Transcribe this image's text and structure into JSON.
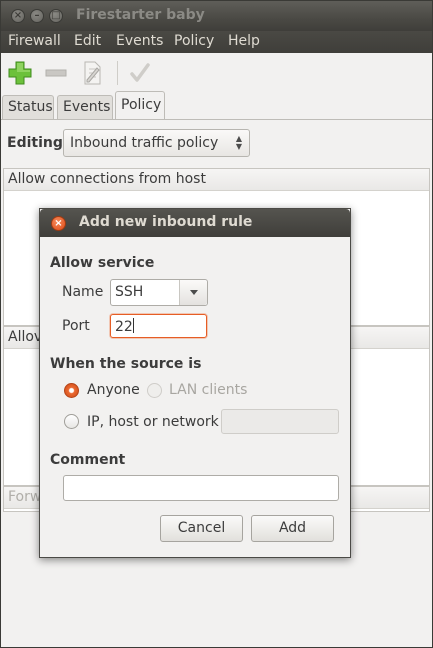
{
  "window": {
    "title": "Firestarter baby",
    "controls": {
      "close": "close-icon",
      "minimize": "minimize-icon",
      "maximize": "maximize-icon"
    }
  },
  "menubar": {
    "items": [
      "Firewall",
      "Edit",
      "Events",
      "Policy",
      "Help"
    ]
  },
  "toolbar": {
    "icons": [
      "add-icon",
      "remove-icon",
      "edit-icon",
      "apply-icon"
    ]
  },
  "tabs": [
    {
      "label": "Status",
      "active": false
    },
    {
      "label": "Events",
      "active": false
    },
    {
      "label": "Policy",
      "active": true
    }
  ],
  "policy": {
    "editing_label": "Editing",
    "selected_policy": "Inbound traffic policy",
    "sections": {
      "allow_host": "Allow connections from host",
      "allow_service_partial": "Allov",
      "forward_partial": "Forw"
    }
  },
  "dialog": {
    "title": "Add new inbound rule",
    "allow_service_heading": "Allow service",
    "name_label": "Name",
    "name_value": "SSH",
    "port_label": "Port",
    "port_value": "22",
    "source_heading": "When the source is",
    "radio_anyone": "Anyone",
    "radio_lan": "LAN clients",
    "radio_ip": "IP, host or network",
    "comment_heading": "Comment",
    "comment_value": "",
    "cancel_label": "Cancel",
    "add_label": "Add"
  },
  "colors": {
    "accent": "#e65d25",
    "titlebar": "#3f3e3a",
    "window_bg": "#f2f1f0"
  }
}
